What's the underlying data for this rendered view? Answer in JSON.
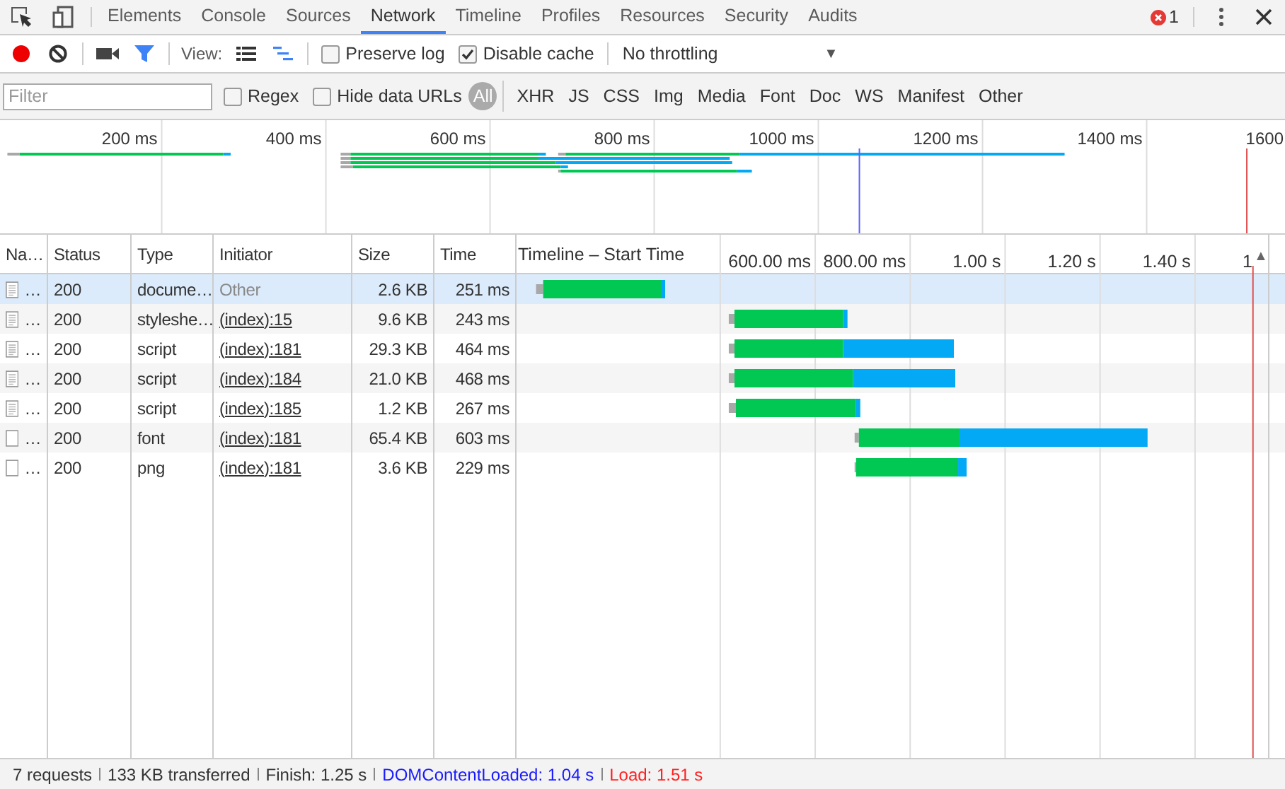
{
  "tabs": [
    {
      "label": "Elements",
      "selected": false
    },
    {
      "label": "Console",
      "selected": false
    },
    {
      "label": "Sources",
      "selected": false
    },
    {
      "label": "Network",
      "selected": true
    },
    {
      "label": "Timeline",
      "selected": false
    },
    {
      "label": "Profiles",
      "selected": false
    },
    {
      "label": "Resources",
      "selected": false
    },
    {
      "label": "Security",
      "selected": false
    },
    {
      "label": "Audits",
      "selected": false
    }
  ],
  "error_count": "1",
  "toolbar": {
    "recording": true,
    "filter_active": true,
    "view_label": "View:",
    "views": [
      {
        "kind": "list",
        "selected": false
      },
      {
        "kind": "waterfall",
        "selected": true
      }
    ],
    "checkboxes": [
      {
        "label": "Preserve log",
        "checked": false
      },
      {
        "label": "Disable cache",
        "checked": true
      }
    ],
    "throttling": "No throttling",
    "caret": "▼"
  },
  "filter_bar": {
    "placeholder": "Filter",
    "checkboxes": [
      {
        "label": "Regex",
        "checked": false
      },
      {
        "label": "Hide data URLs",
        "checked": false
      }
    ],
    "types": [
      {
        "label": "All",
        "selected": true
      },
      {
        "label": "XHR",
        "selected": false
      },
      {
        "label": "JS",
        "selected": false
      },
      {
        "label": "CSS",
        "selected": false
      },
      {
        "label": "Img",
        "selected": false
      },
      {
        "label": "Media",
        "selected": false
      },
      {
        "label": "Font",
        "selected": false
      },
      {
        "label": "Doc",
        "selected": false
      },
      {
        "label": "WS",
        "selected": false
      },
      {
        "label": "Manifest",
        "selected": false
      },
      {
        "label": "Other",
        "selected": false
      }
    ]
  },
  "overview": {
    "tick_labels": [
      "200 ms",
      "400 ms",
      "600 ms",
      "800 ms",
      "1000 ms",
      "1200 ms",
      "1400 ms",
      "1600"
    ]
  },
  "table": {
    "columns": [
      {
        "label": "Na…"
      },
      {
        "label": "Status"
      },
      {
        "label": "Type"
      },
      {
        "label": "Initiator"
      },
      {
        "label": "Size"
      },
      {
        "label": "Time"
      },
      {
        "label": "Timeline – Start Time"
      }
    ],
    "rows": [
      {
        "kind": "text-file",
        "name": "…",
        "status": "200",
        "type": "docume…",
        "initiator": "Other",
        "initiator_link": false,
        "size": "2.6 KB",
        "time": "251 ms",
        "selected": true
      },
      {
        "kind": "text-file",
        "name": "…",
        "status": "200",
        "type": "styleshe…",
        "initiator": "(index):15",
        "initiator_link": true,
        "size": "9.6 KB",
        "time": "243 ms",
        "selected": false
      },
      {
        "kind": "text-file",
        "name": "…",
        "status": "200",
        "type": "script",
        "initiator": "(index):181",
        "initiator_link": true,
        "size": "29.3 KB",
        "time": "464 ms",
        "selected": false
      },
      {
        "kind": "text-file",
        "name": "…",
        "status": "200",
        "type": "script",
        "initiator": "(index):184",
        "initiator_link": true,
        "size": "21.0 KB",
        "time": "468 ms",
        "selected": false
      },
      {
        "kind": "text-file",
        "name": "…",
        "status": "200",
        "type": "script",
        "initiator": "(index):185",
        "initiator_link": true,
        "size": "1.2 KB",
        "time": "267 ms",
        "selected": false
      },
      {
        "kind": "blank-file",
        "name": "…",
        "status": "200",
        "type": "font",
        "initiator": "(index):181",
        "initiator_link": true,
        "size": "65.4 KB",
        "time": "603 ms",
        "selected": false
      },
      {
        "kind": "blank-file",
        "name": "…",
        "status": "200",
        "type": "png",
        "initiator": "(index):181",
        "initiator_link": true,
        "size": "3.6 KB",
        "time": "229 ms",
        "selected": false
      }
    ],
    "sort_indicator": "▲",
    "timeline_tick_labels": [
      "600.00 ms",
      "800.00 ms",
      "1.00 s",
      "1.20 s",
      "1.40 s",
      "1"
    ]
  },
  "status_bar": [
    {
      "text": "7 requests",
      "color": "#333333"
    },
    {
      "text": "133 KB transferred",
      "color": "#333333"
    },
    {
      "text": "Finish: 1.25 s",
      "color": "#333333"
    },
    {
      "text": "DOMContentLoaded: 1.04 s",
      "color": "#1a1aff"
    },
    {
      "text": "Load: 1.51 s",
      "color": "#ff2020"
    }
  ]
}
